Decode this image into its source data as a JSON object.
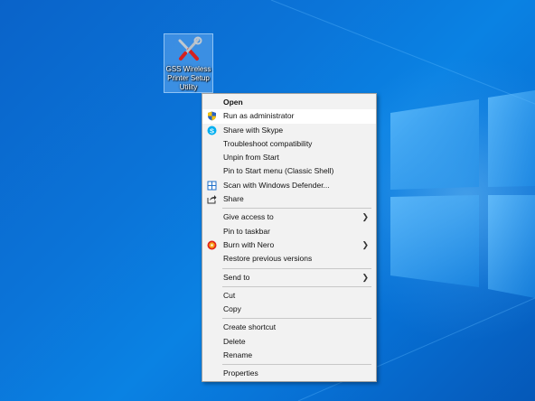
{
  "desktop": {
    "icon": {
      "label": "GSS Wireless Printer Setup Utility",
      "icon": "wrench-screwdriver-icon"
    }
  },
  "context_menu": {
    "items": [
      {
        "label": "Open",
        "bold": true
      },
      {
        "label": "Run as administrator",
        "icon": "uac-shield-icon",
        "hover": true
      },
      {
        "label": "Share with Skype",
        "icon": "skype-icon"
      },
      {
        "label": "Troubleshoot compatibility"
      },
      {
        "label": "Unpin from Start"
      },
      {
        "label": "Pin to Start menu (Classic Shell)"
      },
      {
        "label": "Scan with Windows Defender...",
        "icon": "windows-defender-icon"
      },
      {
        "label": "Share",
        "icon": "share-icon"
      },
      {
        "label": "Give access to",
        "submenu": true
      },
      {
        "label": "Pin to taskbar"
      },
      {
        "label": "Burn with Nero",
        "icon": "nero-icon",
        "submenu": true
      },
      {
        "label": "Restore previous versions"
      },
      {
        "label": "Send to",
        "submenu": true
      },
      {
        "label": "Cut"
      },
      {
        "label": "Copy"
      },
      {
        "label": "Create shortcut"
      },
      {
        "label": "Delete"
      },
      {
        "label": "Rename"
      },
      {
        "label": "Properties"
      }
    ]
  },
  "colors": {
    "desktop_background": "#0b74d8",
    "menu_background": "#f2f2f2",
    "menu_hover": "#ffffff",
    "skype_blue": "#00aff0",
    "defender_blue": "#1e6fc9"
  }
}
